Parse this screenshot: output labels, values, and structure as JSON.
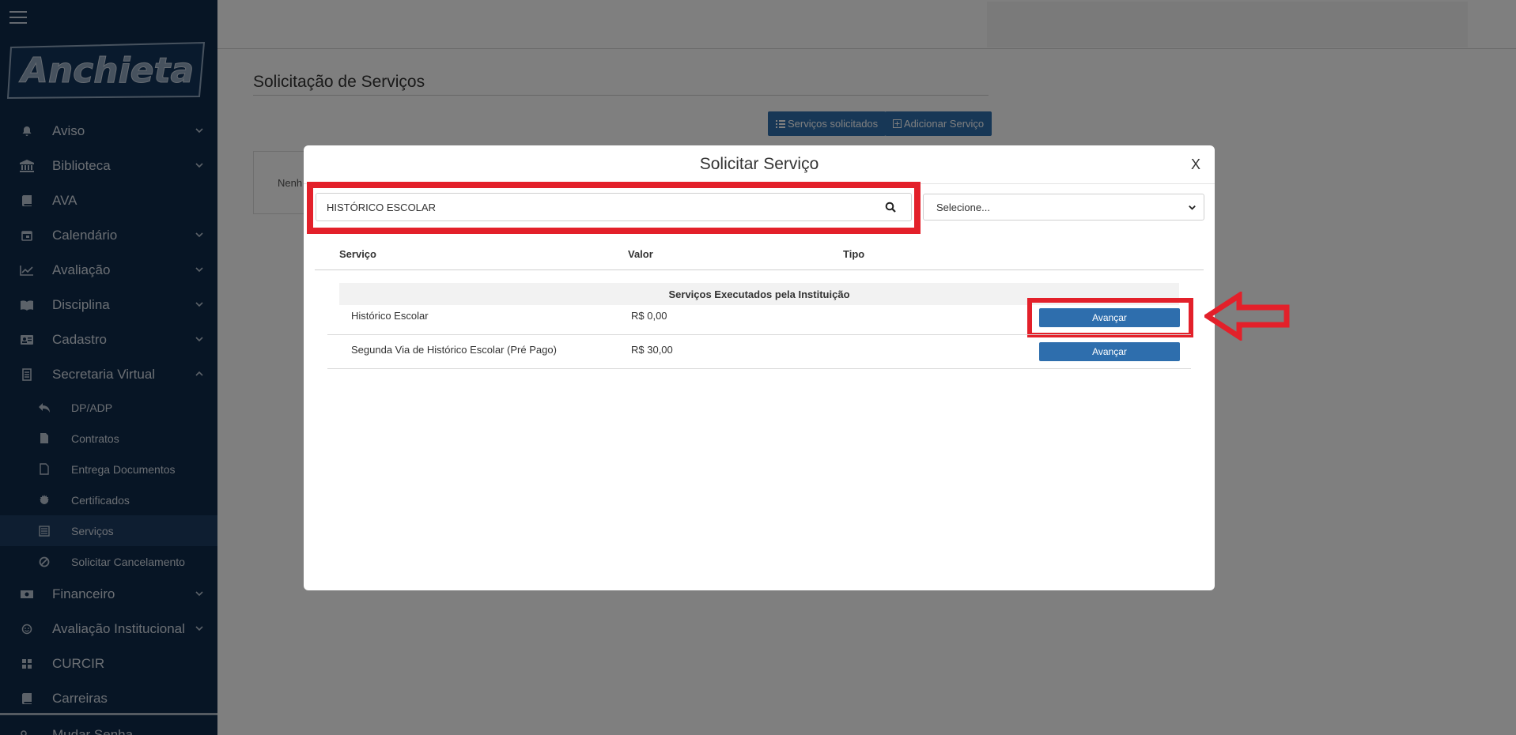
{
  "sidebar": {
    "logo_text": "Anchieta",
    "items": [
      {
        "label": "Aviso",
        "icon": "bell-icon"
      },
      {
        "label": "Biblioteca",
        "icon": "bank-icon"
      },
      {
        "label": "AVA",
        "icon": "book-icon"
      },
      {
        "label": "Calendário",
        "icon": "calendar-icon"
      },
      {
        "label": "Avaliação",
        "icon": "chart-line-icon"
      },
      {
        "label": "Disciplina",
        "icon": "open-book-icon"
      },
      {
        "label": "Cadastro",
        "icon": "id-card-icon"
      },
      {
        "label": "Secretaria Virtual",
        "icon": "document-icon"
      }
    ],
    "sub_items": [
      {
        "label": "DP/ADP",
        "icon": "reply-icon"
      },
      {
        "label": "Contratos",
        "icon": "file-icon"
      },
      {
        "label": "Entrega Documentos",
        "icon": "file-outline-icon"
      },
      {
        "label": "Certificados",
        "icon": "certificate-icon"
      },
      {
        "label": "Serviços",
        "icon": "list-doc-icon"
      },
      {
        "label": "Solicitar Cancelamento",
        "icon": "ban-icon"
      }
    ],
    "items_after": [
      {
        "label": "Financeiro",
        "icon": "money-icon"
      },
      {
        "label": "Avaliação Institucional",
        "icon": "smile-icon"
      },
      {
        "label": "CURCIR",
        "icon": "grid-icon"
      },
      {
        "label": "Carreiras",
        "icon": "book-icon"
      }
    ],
    "bottom_item": {
      "label": "Mudar Senha",
      "icon": "key-icon"
    }
  },
  "page": {
    "title": "Solicitação de Serviços",
    "btn_solicitados": "Serviços solicitados",
    "btn_adicionar": "Adicionar Serviço",
    "empty_text": "Nenh"
  },
  "modal": {
    "title": "Solicitar Serviço",
    "close": "X",
    "search_value": "HISTÓRICO ESCOLAR",
    "select_value": "Selecione...",
    "columns": [
      "Serviço",
      "Valor",
      "Tipo"
    ],
    "group": "Serviços Executados pela Instituição",
    "rows": [
      {
        "servico": "Histórico Escolar",
        "valor": "R$ 0,00",
        "tipo": "",
        "action": "Avançar"
      },
      {
        "servico": "Segunda Via de Histórico Escolar (Pré Pago)",
        "valor": "R$ 30,00",
        "tipo": "",
        "action": "Avançar"
      }
    ]
  },
  "colors": {
    "sidebar_bg": "#0e2a4a",
    "primary_button": "#2e6ead",
    "highlight": "#e3202a"
  }
}
